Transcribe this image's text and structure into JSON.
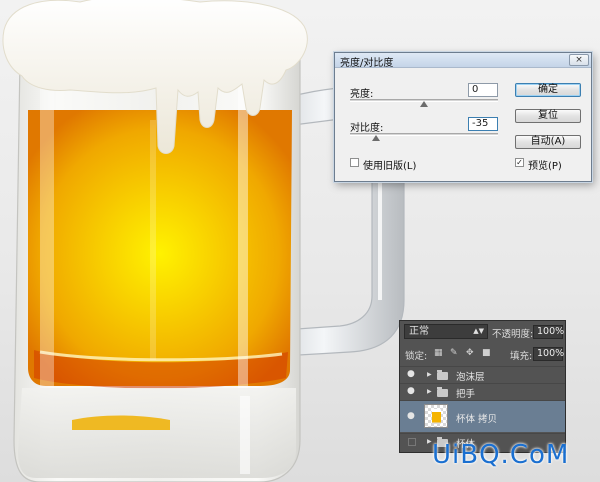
{
  "dialog": {
    "title": "亮度/对比度",
    "close_icon": "×",
    "brightness": {
      "label": "亮度:",
      "value": "0",
      "slider_level": 0.5
    },
    "contrast": {
      "label": "对比度:",
      "value": "-35",
      "slider_level": 0.175
    },
    "use_legacy": {
      "label": "使用旧版(L)",
      "checked": false
    },
    "buttons": {
      "ok": "确定",
      "reset": "复位",
      "auto": "自动(A)"
    },
    "preview": {
      "label": "预览(P)",
      "checked": true,
      "mark": "✓"
    }
  },
  "layers_panel": {
    "blend_mode": "正常",
    "blend_arrow": "▲▼",
    "opacity_label": "不透明度:",
    "opacity_value": "100%",
    "lock_label": "锁定:",
    "lock_icons": [
      "checker-icon",
      "brush-icon",
      "move-icon",
      "lock-icon"
    ],
    "fill_label": "填充:",
    "fill_value": "100%",
    "layers": [
      {
        "name": "泡沫层",
        "type": "group",
        "visible": true
      },
      {
        "name": "把手",
        "type": "group",
        "visible": true
      },
      {
        "name": "杯体 拷贝",
        "type": "layer",
        "visible": true,
        "selected": true
      },
      {
        "name": "杯体",
        "type": "group",
        "visible": false
      }
    ]
  },
  "watermark": "UiBQ.CoM",
  "colors": {
    "beer_core": "#f8d000",
    "beer_edge": "#e07800",
    "foam": "#f8f6ee",
    "dialog_bg": "#f0f0f0",
    "panel_bg": "#535353",
    "selected_layer": "#6a7e93",
    "watermark": "#1a6fd0"
  }
}
